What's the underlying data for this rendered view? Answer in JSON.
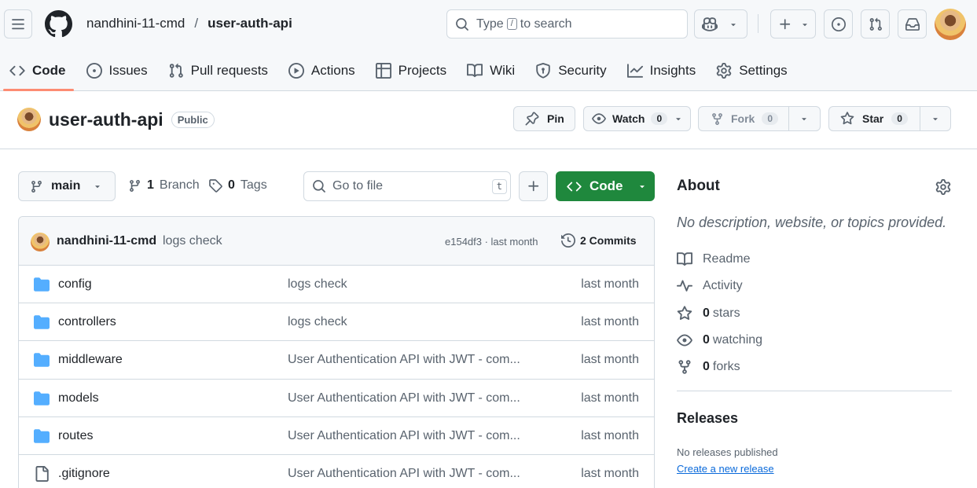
{
  "header": {
    "owner": "nandhini-11-cmd",
    "separator": "/",
    "repo": "user-auth-api",
    "search_prefix": "Type",
    "search_key": "/",
    "search_suffix": "to search"
  },
  "tabs": [
    {
      "label": "Code",
      "icon": "code-icon",
      "active": true
    },
    {
      "label": "Issues",
      "icon": "issue-icon"
    },
    {
      "label": "Pull requests",
      "icon": "pull-request-icon"
    },
    {
      "label": "Actions",
      "icon": "play-icon"
    },
    {
      "label": "Projects",
      "icon": "table-icon"
    },
    {
      "label": "Wiki",
      "icon": "book-icon"
    },
    {
      "label": "Security",
      "icon": "shield-icon"
    },
    {
      "label": "Insights",
      "icon": "graph-icon"
    },
    {
      "label": "Settings",
      "icon": "gear-icon"
    }
  ],
  "repo_header": {
    "name": "user-auth-api",
    "visibility": "Public",
    "pin_label": "Pin",
    "watch_label": "Watch",
    "watch_count": "0",
    "fork_label": "Fork",
    "fork_count": "0",
    "star_label": "Star",
    "star_count": "0"
  },
  "branch_bar": {
    "branch": "main",
    "branch_count": "1",
    "branch_label": "Branch",
    "tag_count": "0",
    "tag_label": "Tags",
    "goto_placeholder": "Go to file",
    "goto_key": "t",
    "code_label": "Code"
  },
  "latest_commit": {
    "author": "nandhini-11-cmd",
    "message": "logs check",
    "hash_age": "e154df3 · last month",
    "commits_label": "2 Commits"
  },
  "files": [
    {
      "name": "config",
      "type": "folder",
      "message": "logs check",
      "age": "last month"
    },
    {
      "name": "controllers",
      "type": "folder",
      "message": "logs check",
      "age": "last month"
    },
    {
      "name": "middleware",
      "type": "folder",
      "message": "User Authentication API with JWT - com...",
      "age": "last month"
    },
    {
      "name": "models",
      "type": "folder",
      "message": "User Authentication API with JWT - com...",
      "age": "last month"
    },
    {
      "name": "routes",
      "type": "folder",
      "message": "User Authentication API with JWT - com...",
      "age": "last month"
    },
    {
      "name": ".gitignore",
      "type": "file",
      "message": "User Authentication API with JWT - com...",
      "age": "last month"
    }
  ],
  "about": {
    "title": "About",
    "description": "No description, website, or topics provided.",
    "readme": "Readme",
    "activity": "Activity",
    "stars_count": "0",
    "stars_label": "stars",
    "watching_count": "0",
    "watching_label": "watching",
    "forks_count": "0",
    "forks_label": "forks"
  },
  "releases": {
    "title": "Releases",
    "none": "No releases published",
    "create_link": "Create a new release"
  },
  "colors": {
    "accent_green": "#1f883d",
    "tab_underline": "#fd8c73",
    "folder_blue": "#54aeff",
    "link_blue": "#0969da"
  }
}
